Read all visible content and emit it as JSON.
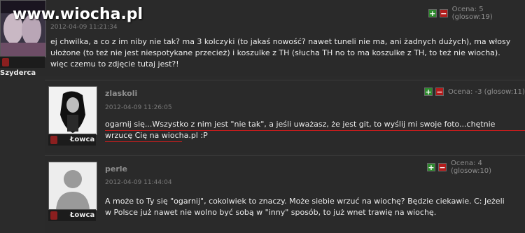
{
  "watermark": "www.wiocha.pl",
  "comments": [
    {
      "user": "",
      "date": "2012-04-09 11:21:34",
      "rank": "Szyderca",
      "score": "Ocena: 5 (glosow:19)",
      "text": "ej chwilka, a co z im niby nie tak? ma 3 kolczyki (to jakaś nowość? nawet tuneli nie ma, ani żadnych dużych), ma włosy ułożone (to też nie jest niespotykane przecież) i koszulke z TH (słucha TH no to ma koszulke z TH, to też nie wiocha). więc czemu to zdjęcie tutaj jest?!"
    },
    {
      "user": "zlaskoli",
      "date": "2012-04-09 11:26:05",
      "rank": "Łowca",
      "score": "Ocena: -3 (glosow:11)",
      "text": "ogarnij się...Wszystko z nim jest \"nie tak\", a jeśli uważasz, że jest git, to wyślij mi swoje foto...chętnie wrzucę Cię na wiocha.pl :P"
    },
    {
      "user": "perle",
      "date": "2012-04-09 11:44:04",
      "rank": "Łowca",
      "score": "Ocena: 4 (glosow:10)",
      "text": "A może to Ty się \"ogarnij\", cokolwiek to znaczy. Może siebie wrzuć na wiochę? Będzie ciekawie. C: Jeżeli w Polsce już nawet nie wolno być sobą w \"inny\" sposób, to już wnet trawię na wiochę."
    }
  ],
  "vote": {
    "plus": "+",
    "minus": "−"
  },
  "colors": {
    "plus": "#2e8a2e",
    "minus": "#b31c1c",
    "underline": "#c21d1d"
  }
}
